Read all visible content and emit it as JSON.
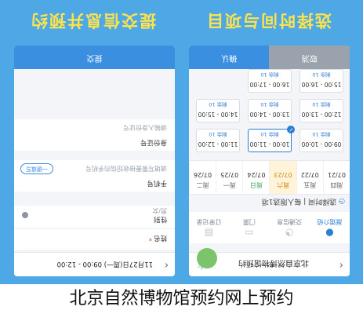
{
  "panels": {
    "left_title": "选择时间与项目",
    "right_title": "提交信息并预约"
  },
  "time_picker": {
    "header_title": "北京自然博物馆预约",
    "tabs": [
      {
        "label": "展馆介绍"
      },
      {
        "label": "交通信息"
      },
      {
        "label": "门票"
      },
      {
        "label": "订单记录"
      }
    ],
    "section_label": "选择时间 | 每人限选1项",
    "dates": [
      {
        "weekday": "周四",
        "date": "07/21"
      },
      {
        "weekday": "周五",
        "date": "07/22"
      },
      {
        "weekday": "周六",
        "date": "07/23",
        "selected": true
      },
      {
        "weekday": "周日",
        "date": "07/24"
      },
      {
        "weekday": "周一",
        "date": "07/25"
      },
      {
        "weekday": "周二",
        "date": "07/26"
      }
    ],
    "slots": [
      {
        "time": "09:00 - 10:00",
        "status": "剩余 10"
      },
      {
        "time": "10:00 - 11:00",
        "status": "剩余 10",
        "selected": true
      },
      {
        "time": "11:00 - 12:00",
        "status": "剩余 10"
      },
      {
        "time": "12:00 - 13:00",
        "status": "剩余 10"
      },
      {
        "time": "13:00 - 14:00",
        "status": "剩余 10"
      },
      {
        "time": "14:00 - 15:00",
        "status": "剩余 10"
      },
      {
        "time": "15:00 - 16:00",
        "status": "剩余 10"
      },
      {
        "time": "16:00 - 17:00",
        "status": "剩余 10"
      }
    ],
    "cancel_label": "取消",
    "confirm_label": "确认"
  },
  "form": {
    "header_info": "11月27日(周一) 09:00 - 12:00",
    "fields": [
      {
        "label": "姓名",
        "required": true,
        "value": ""
      },
      {
        "label": "性别",
        "value": "男/女"
      },
      {
        "label": "手机号",
        "value": "请填写需要接收短信的手机号",
        "button": "一键填写"
      },
      {
        "label": "身份证号",
        "value": "请输入身份证号"
      }
    ],
    "submit_label": "提交"
  },
  "caption": "北京自然博物馆预约网上预约"
}
